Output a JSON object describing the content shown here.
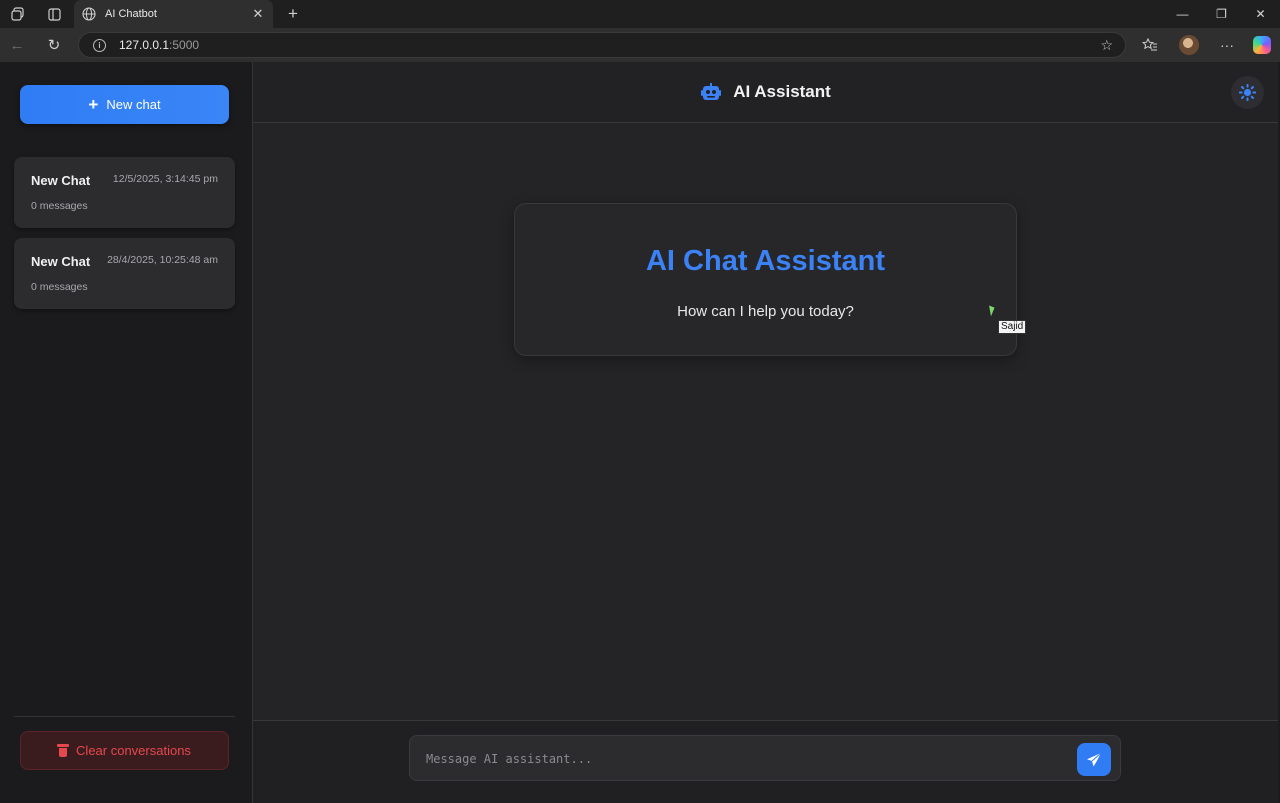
{
  "browser": {
    "tab_title": "AI Chatbot",
    "url_host": "127.0.0.1",
    "url_port": ":5000"
  },
  "sidebar": {
    "new_chat_label": "New chat",
    "conversations": [
      {
        "title": "New Chat",
        "date": "12/5/2025, 3:14:45 pm",
        "count": "0 messages"
      },
      {
        "title": "New Chat",
        "date": "28/4/2025, 10:25:48 am",
        "count": "0 messages"
      }
    ],
    "clear_label": "Clear conversations"
  },
  "header": {
    "title": "AI Assistant"
  },
  "welcome": {
    "title": "AI Chat Assistant",
    "subtitle": "How can I help you today?"
  },
  "tooltip": "Sajid",
  "composer": {
    "placeholder": "Message AI assistant..."
  },
  "colors": {
    "accent": "#3b82f6",
    "danger": "#e5484d"
  }
}
